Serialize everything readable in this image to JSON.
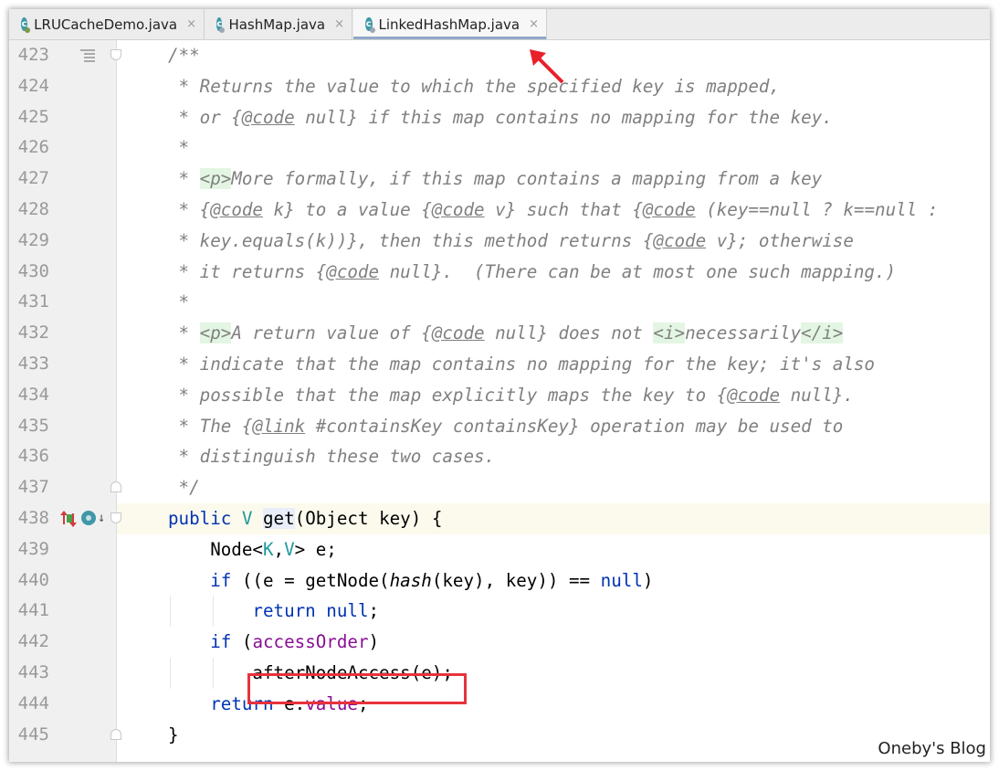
{
  "tabs": [
    {
      "label": "LRUCacheDemo.java",
      "active": false
    },
    {
      "label": "HashMap.java",
      "active": false
    },
    {
      "label": "LinkedHashMap.java",
      "active": true
    }
  ],
  "tab_close_glyph": "×",
  "class_icon_letter": "c",
  "colors": {
    "keyword": "#0033b3",
    "comment": "#808080",
    "type_param": "#20999d",
    "field": "#871094",
    "highlight_box": "#e8323c",
    "current_line": "#fcfaed"
  },
  "icons": {
    "structure": "structure-icon",
    "override": "override-method-icon",
    "implemented": "implemented-icon",
    "navigate": "navigate-down-icon"
  },
  "lines": [
    {
      "num": "423",
      "text": "/**"
    },
    {
      "num": "424",
      "text": " * Returns the value to which the specified key is mapped,"
    },
    {
      "num": "425",
      "text": " * or {@code null} if this map contains no mapping for the key."
    },
    {
      "num": "426",
      "text": " *"
    },
    {
      "num": "427",
      "text": " * <p>More formally, if this map contains a mapping from a key"
    },
    {
      "num": "428",
      "text": " * {@code k} to a value {@code v} such that {@code (key==null ? k==null :"
    },
    {
      "num": "429",
      "text": " * key.equals(k))}, then this method returns {@code v}; otherwise"
    },
    {
      "num": "430",
      "text": " * it returns {@code null}.  (There can be at most one such mapping.)"
    },
    {
      "num": "431",
      "text": " *"
    },
    {
      "num": "432",
      "text": " * <p>A return value of {@code null} does not <i>necessarily</i>"
    },
    {
      "num": "433",
      "text": " * indicate that the map contains no mapping for the key; it's also"
    },
    {
      "num": "434",
      "text": " * possible that the map explicitly maps the key to {@code null}."
    },
    {
      "num": "435",
      "text": " * The {@link #containsKey containsKey} operation may be used to"
    },
    {
      "num": "436",
      "text": " * distinguish these two cases."
    },
    {
      "num": "437",
      "text": " */"
    },
    {
      "num": "438",
      "text": "public V get(Object key) {"
    },
    {
      "num": "439",
      "text": "    Node<K,V> e;"
    },
    {
      "num": "440",
      "text": "    if ((e = getNode(hash(key), key)) == null)"
    },
    {
      "num": "441",
      "text": "        return null;"
    },
    {
      "num": "442",
      "text": "    if (accessOrder)"
    },
    {
      "num": "443",
      "text": "        afterNodeAccess(e);"
    },
    {
      "num": "444",
      "text": "    return e.value;"
    },
    {
      "num": "445",
      "text": "}"
    }
  ],
  "watermark": "Oneby's Blog"
}
